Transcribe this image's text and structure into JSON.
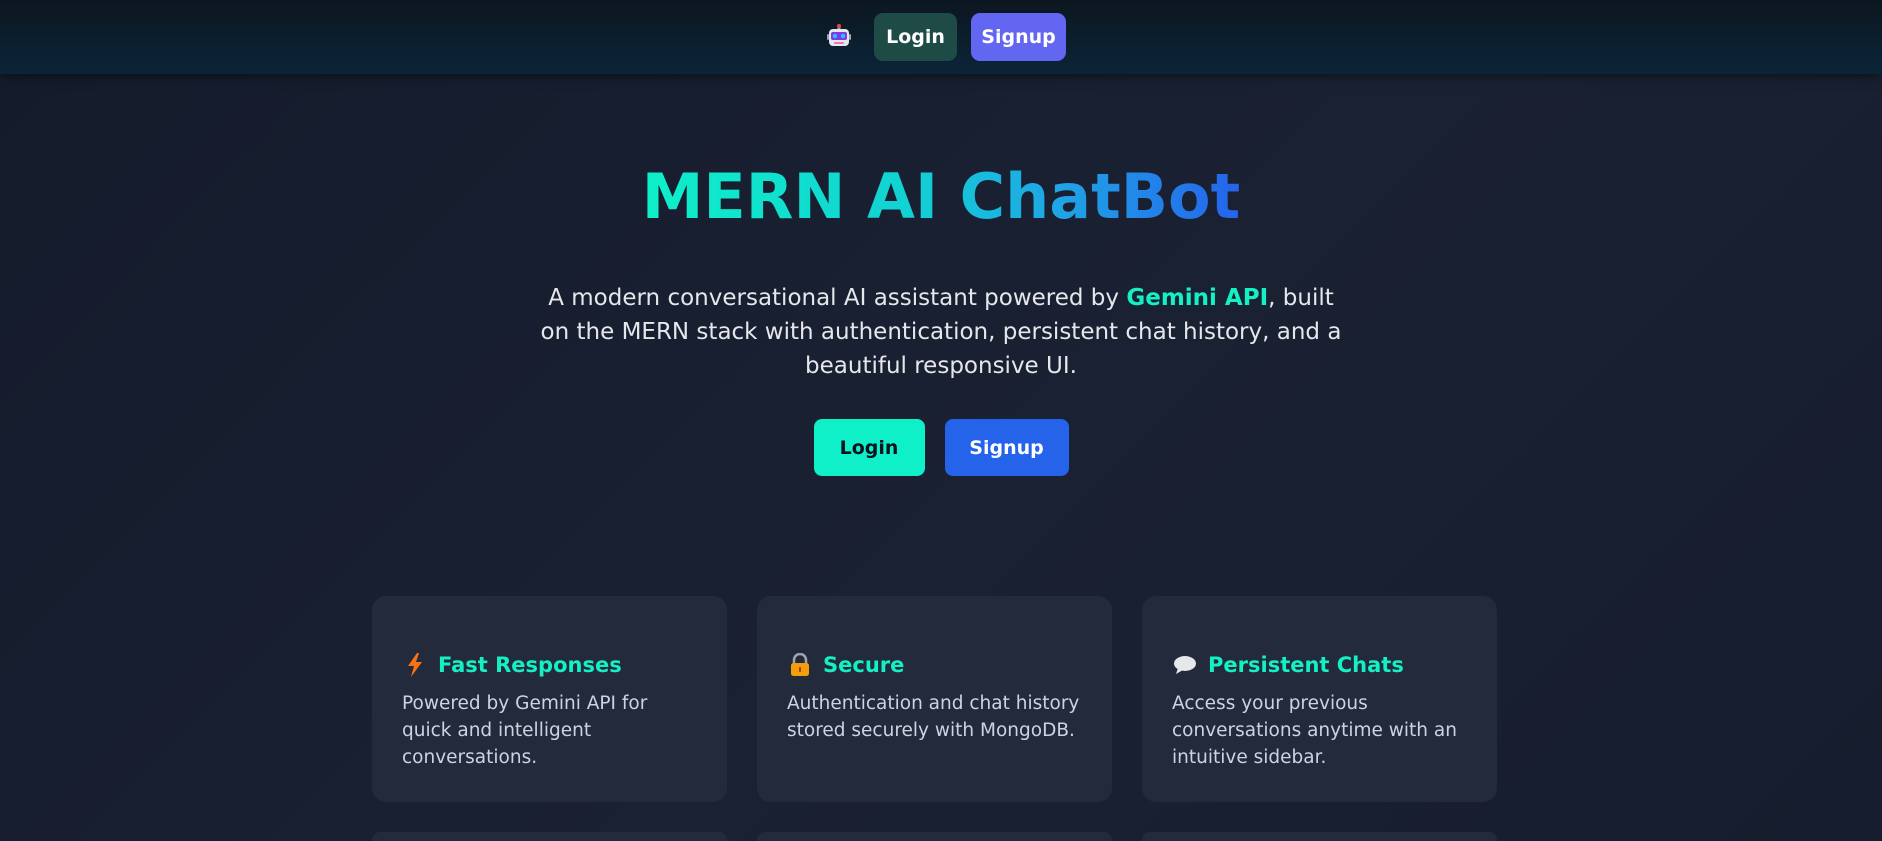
{
  "nav": {
    "logo_icon": "robot-icon",
    "login_label": "Login",
    "signup_label": "Signup"
  },
  "hero": {
    "title": "MERN AI ChatBot",
    "description_before": "A modern conversational AI assistant powered by ",
    "description_accent": "Gemini API",
    "description_after": ", built on the MERN stack with authentication, persistent chat history, and a beautiful responsive UI.",
    "login_label": "Login",
    "signup_label": "Signup"
  },
  "features": [
    {
      "icon": "lightning-icon",
      "title": "Fast Responses",
      "text": "Powered by Gemini API for quick and intelligent conversations."
    },
    {
      "icon": "lock-icon",
      "title": "Secure",
      "text": "Authentication and chat history stored securely with MongoDB."
    },
    {
      "icon": "speech-bubble-icon",
      "title": "Persistent Chats",
      "text": "Access your previous conversations anytime with an intuitive sidebar."
    }
  ],
  "colors": {
    "accent": "#14f0c4",
    "primary_blue": "#2563eb",
    "nav_signup": "#6366f1",
    "nav_login": "#1f4b47",
    "card_bg": "#222a3b",
    "page_bg": "#161d2e"
  }
}
